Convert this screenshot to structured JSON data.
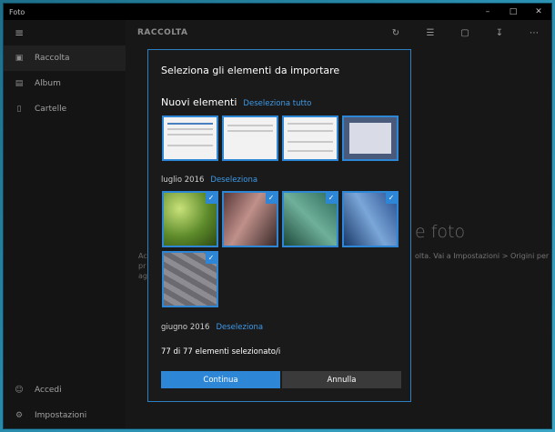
{
  "window": {
    "title": "Foto",
    "controls": [
      "minimize-icon",
      "maximize-icon",
      "close-icon"
    ]
  },
  "sidebar": {
    "items": [
      {
        "label": "Raccolta",
        "icon": "collection-icon",
        "active": true
      },
      {
        "label": "Album",
        "icon": "album-icon",
        "active": false
      },
      {
        "label": "Cartelle",
        "icon": "folder-icon",
        "active": false
      }
    ],
    "bottom_items": [
      {
        "label": "Accedi",
        "icon": "person-icon"
      },
      {
        "label": "Impostazioni",
        "icon": "gear-icon"
      }
    ]
  },
  "main": {
    "heading": "RACCOLTA",
    "toolbar_icons": [
      "refresh-icon",
      "select-icon",
      "slideshow-icon",
      "import-icon",
      "more-icon"
    ],
    "background_title_fragment": "e foto",
    "background_left_fragment": [
      "Ac",
      "pr",
      "ag"
    ],
    "background_right_fragment": "olta. Vai a Impostazioni > Origini per"
  },
  "dialog": {
    "title": "Seleziona gli elementi da importare",
    "new_section": {
      "label": "Nuovi elementi",
      "link": "Deseleziona tutto"
    },
    "july_section": {
      "label": "luglio 2016",
      "link": "Deseleziona"
    },
    "june_section": {
      "label": "giugno 2016",
      "link": "Deseleziona"
    },
    "status": "77 di 77 elementi selezionato/i",
    "continue_label": "Continua",
    "cancel_label": "Annulla"
  },
  "colors": {
    "accent": "#2e86d6",
    "link": "#3f9ae8",
    "background": "#1f1f1f"
  }
}
